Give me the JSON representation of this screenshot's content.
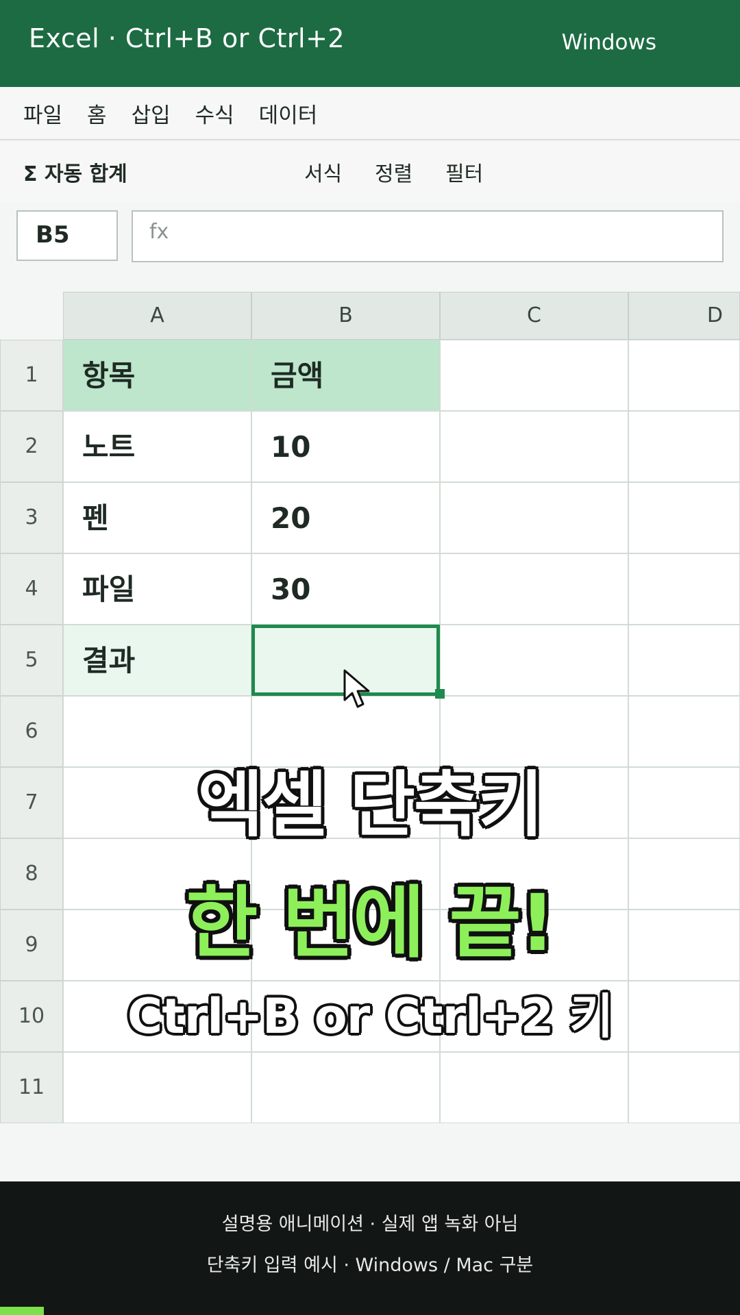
{
  "header": {
    "title": "Excel · Ctrl+B or Ctrl+2",
    "platform": "Windows"
  },
  "menu": {
    "items": [
      "파일",
      "홈",
      "삽입",
      "수식",
      "데이터"
    ]
  },
  "ribbon": {
    "autosum": "Σ 자동 합계",
    "format": "서식",
    "sort": "정렬",
    "filter": "필터"
  },
  "formula_bar": {
    "name_box": "B5",
    "fx_label": "fx",
    "value": ""
  },
  "sheet": {
    "columns": [
      "A",
      "B",
      "C",
      "D"
    ],
    "rows": [
      "1",
      "2",
      "3",
      "4",
      "5",
      "6",
      "7",
      "8",
      "9",
      "10",
      "11"
    ],
    "cells": {
      "A1": "항목",
      "B1": "금액",
      "A2": "노트",
      "B2": "10",
      "A3": "펜",
      "B3": "20",
      "A4": "파일",
      "B4": "30",
      "A5": "결과",
      "B5": ""
    },
    "selected_cell": "B5"
  },
  "overlay": {
    "line1": "엑셀 단축키",
    "line2": "한 번에 끝!",
    "line3": "Ctrl+B or Ctrl+2 키"
  },
  "footer": {
    "line1": "설명용 애니메이션 · 실제 앱 녹화 아님",
    "line2": "단축키 입력 예시 · Windows / Mac 구분"
  },
  "colors": {
    "header_bg": "#1d6b43",
    "accent_green": "#8df05a",
    "selection": "#1e8a4c",
    "header_row": "#bde6cc"
  },
  "icons": {
    "cursor": "mouse-pointer-icon"
  }
}
